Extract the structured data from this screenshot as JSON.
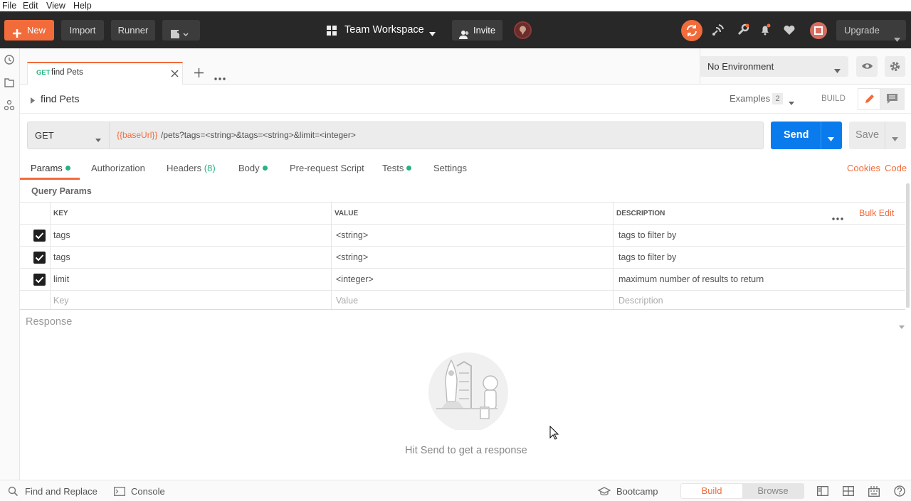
{
  "menubar": {
    "file": "File",
    "edit": "Edit",
    "view": "View",
    "help": "Help"
  },
  "header": {
    "new_label": "New",
    "import_label": "Import",
    "runner_label": "Runner",
    "workspace_label": "Team Workspace",
    "invite_label": "Invite",
    "upgrade_label": "Upgrade"
  },
  "tabs": {
    "active_method": "GET",
    "active_name": "find Pets"
  },
  "environment": {
    "selected": "No Environment"
  },
  "request": {
    "title": "find Pets",
    "examples_label": "Examples",
    "examples_count": "2",
    "build_label": "BUILD",
    "method": "GET",
    "url_var": "{{baseUrl}}",
    "url_rest": "/pets?tags=<string>&tags=<string>&limit=<integer>",
    "send_label": "Send",
    "save_label": "Save"
  },
  "request_tabs": {
    "params": "Params",
    "authorization": "Authorization",
    "headers": "Headers",
    "headers_count": "(8)",
    "body": "Body",
    "prerequest": "Pre-request Script",
    "tests": "Tests",
    "settings": "Settings",
    "cookies": "Cookies",
    "code": "Code"
  },
  "query_params": {
    "title": "Query Params",
    "columns": {
      "key": "KEY",
      "value": "VALUE",
      "description": "DESCRIPTION"
    },
    "bulk_edit": "Bulk Edit",
    "rows": [
      {
        "key": "tags",
        "value": "<string>",
        "description": "tags to filter by",
        "checked": true
      },
      {
        "key": "tags",
        "value": "<string>",
        "description": "tags to filter by",
        "checked": true
      },
      {
        "key": "limit",
        "value": "<integer>",
        "description": "maximum number of results to return",
        "checked": true
      }
    ],
    "placeholders": {
      "key": "Key",
      "value": "Value",
      "description": "Description"
    }
  },
  "response": {
    "title": "Response",
    "empty_message": "Hit Send to get a response"
  },
  "footer": {
    "find_replace": "Find and Replace",
    "console": "Console",
    "bootcamp": "Bootcamp",
    "build": "Build",
    "browse": "Browse"
  },
  "colors": {
    "accent": "#f26b3a",
    "send_blue": "#097bed",
    "header_bg": "#282828",
    "green_dot": "#26b47f"
  }
}
